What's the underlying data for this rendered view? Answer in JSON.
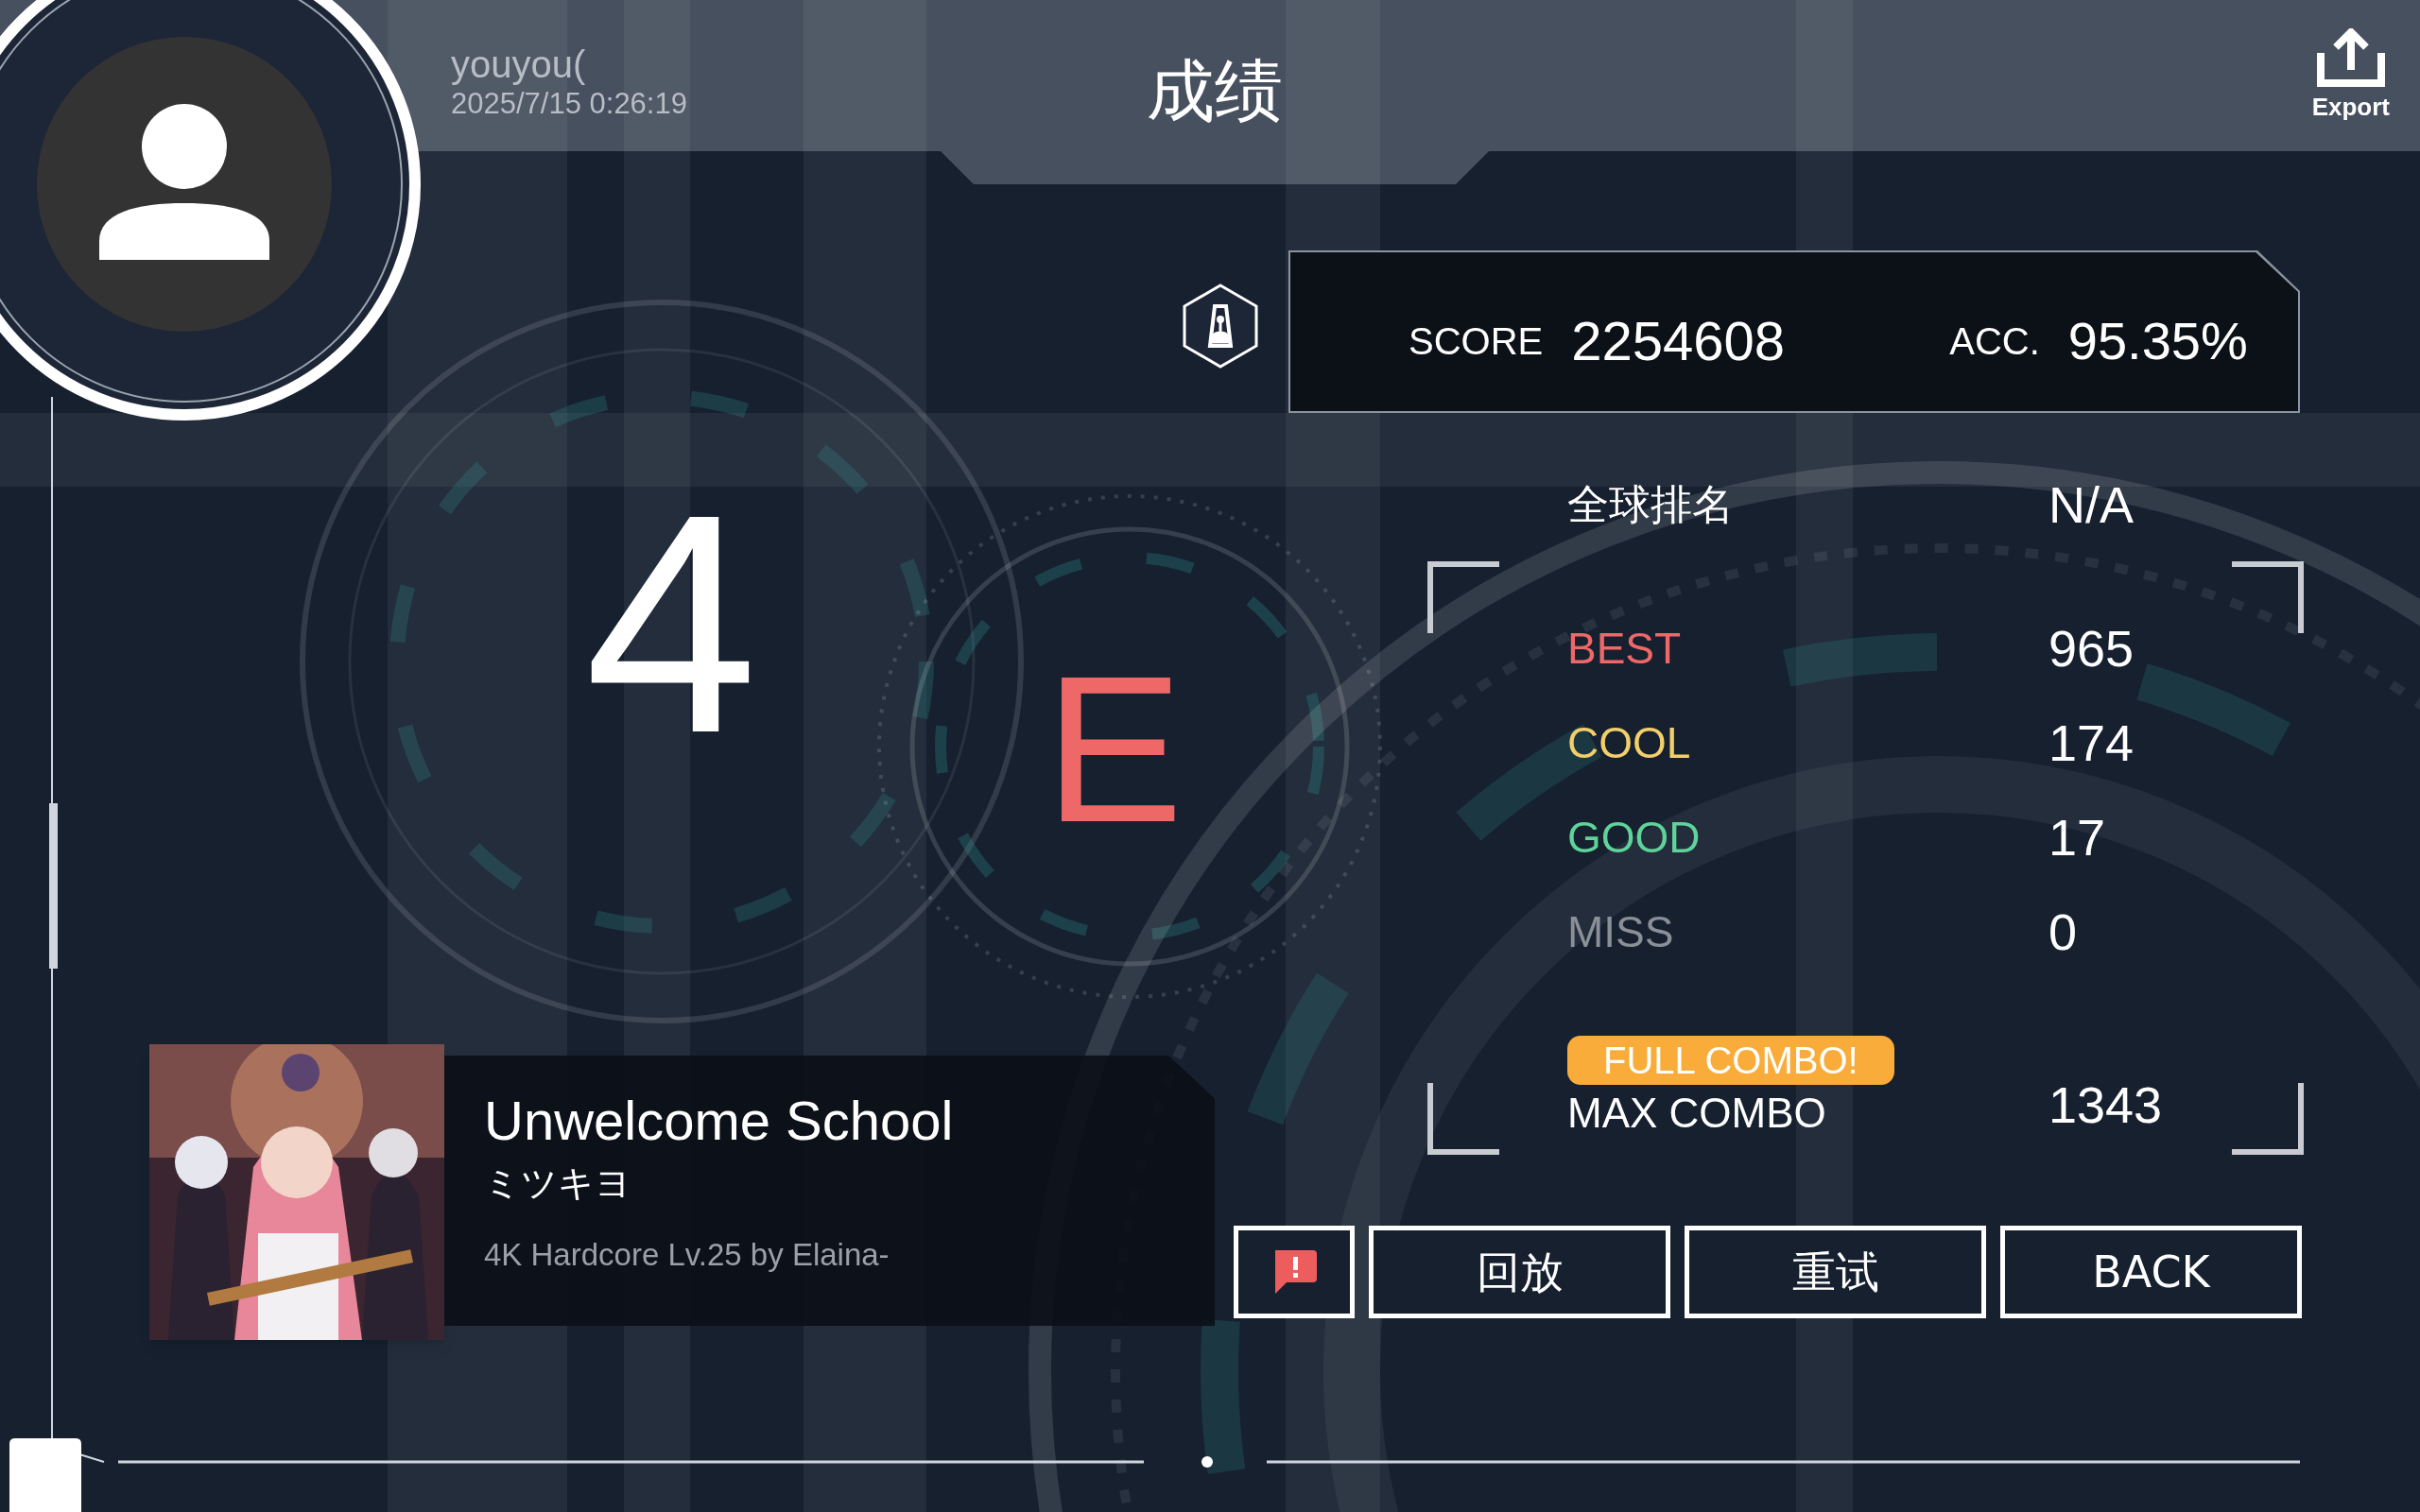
{
  "header": {
    "username": "youyou(",
    "timestamp": "2025/7/15 0:26:19",
    "title": "成绩",
    "export_label": "Export"
  },
  "rank": {
    "key_glyph": "4",
    "grade": "E"
  },
  "score": {
    "score_label": "SCORE",
    "score": "2254608",
    "acc_label": "ACC.",
    "acc": "95.35%"
  },
  "global_rank": {
    "label": "全球排名",
    "value": "N/A"
  },
  "judgements": [
    {
      "label": "BEST",
      "value": "965",
      "color": "#ee6868"
    },
    {
      "label": "COOL",
      "value": "174",
      "color": "#f2cf6b"
    },
    {
      "label": "GOOD",
      "value": "17",
      "color": "#5fd39a"
    },
    {
      "label": "MISS",
      "value": "0",
      "color": "#8a8f98"
    }
  ],
  "combo": {
    "badge": "FULL COMBO!",
    "full_combo": true,
    "label": "MAX COMBO",
    "value": "1343"
  },
  "buttons": [
    {
      "kind": "report"
    },
    {
      "kind": "text",
      "label": "回放"
    },
    {
      "kind": "text",
      "label": "重试"
    },
    {
      "kind": "text",
      "label": "BACK"
    }
  ],
  "song": {
    "title": "Unwelcome School",
    "artist": "ミツキヨ",
    "chart": "4K Hardcore Lv.25 by Elaina-"
  }
}
